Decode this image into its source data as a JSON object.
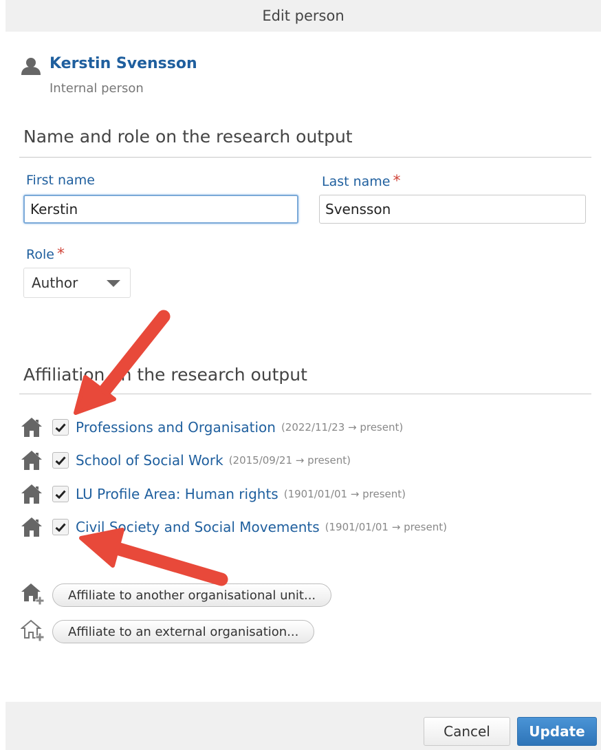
{
  "dialog": {
    "title": "Edit person"
  },
  "person": {
    "name": "Kerstin Svensson",
    "type": "Internal person",
    "icon": "person-icon"
  },
  "name_section": {
    "title": "Name and role on the research output",
    "first_name_label": "First name",
    "first_name_value": "Kerstin",
    "last_name_label": "Last name",
    "last_name_value": "Svensson",
    "required_mark": "*",
    "role_label": "Role",
    "role_value": "Author"
  },
  "affiliation_section": {
    "title": "Affiliation on the research output",
    "items": [
      {
        "name": "Professions and Organisation",
        "dates": "(2022/11/23 → present)",
        "checked": true,
        "icon": "house-icon"
      },
      {
        "name": "School of Social Work",
        "dates": "(2015/09/21 → present)",
        "checked": true,
        "icon": "house-icon"
      },
      {
        "name": "LU Profile Area: Human rights",
        "dates": "(1901/01/01 → present)",
        "checked": true,
        "icon": "house-icon"
      },
      {
        "name": "Civil Society and Social Movements",
        "dates": "(1901/01/01 → present)",
        "checked": true,
        "icon": "house-icon"
      }
    ],
    "affiliate_internal_label": "Affiliate to another organisational unit...",
    "affiliate_external_label": "Affiliate to an external organisation..."
  },
  "footer": {
    "cancel_label": "Cancel",
    "update_label": "Update"
  },
  "colors": {
    "link": "#1f5f9e",
    "required": "#d0453a",
    "annotation_arrow": "#e8493a",
    "primary_button": "#2e74b8"
  }
}
